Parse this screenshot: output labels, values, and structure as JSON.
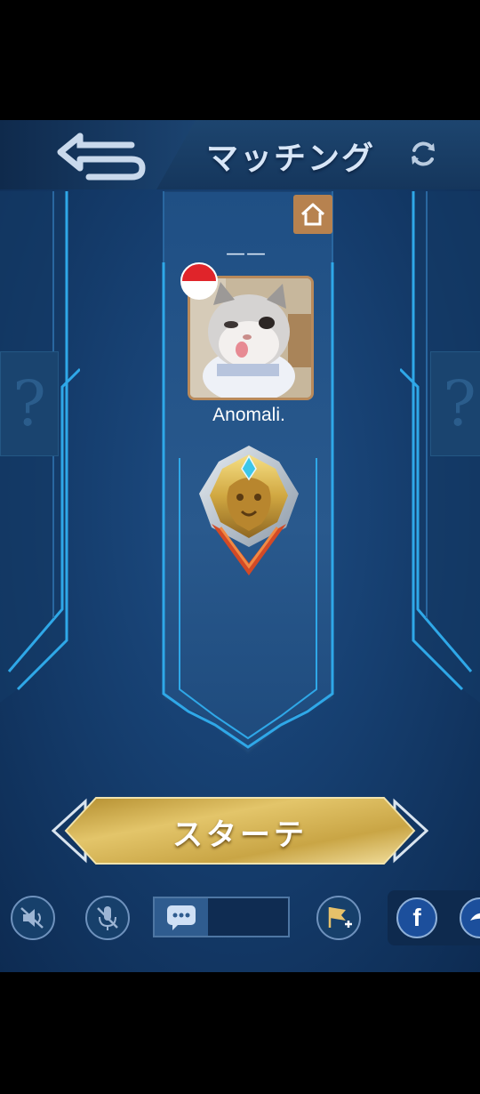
{
  "header": {
    "title": "マッチング"
  },
  "center_slot": {
    "top_text": "——",
    "player_name": "Anomali."
  },
  "start_button": {
    "label": "スターテ"
  },
  "side_slots": {
    "left_placeholder": "?",
    "right_placeholder": "?"
  },
  "bottom_bar": {
    "facebook_label": "f"
  },
  "icons": [
    "back-arrow-icon",
    "refresh-icon",
    "home-icon",
    "flag-icon",
    "rank-emblem-icon",
    "speaker-muted-icon",
    "mic-muted-icon",
    "chat-icon",
    "flag-plus-icon",
    "facebook-icon",
    "share-icon"
  ],
  "colors": {
    "background": "#163f70",
    "panel_border": "#2fa8e8",
    "gold": "#d8b650",
    "home_badge": "#b7824f",
    "flag_red": "#e0242a"
  }
}
